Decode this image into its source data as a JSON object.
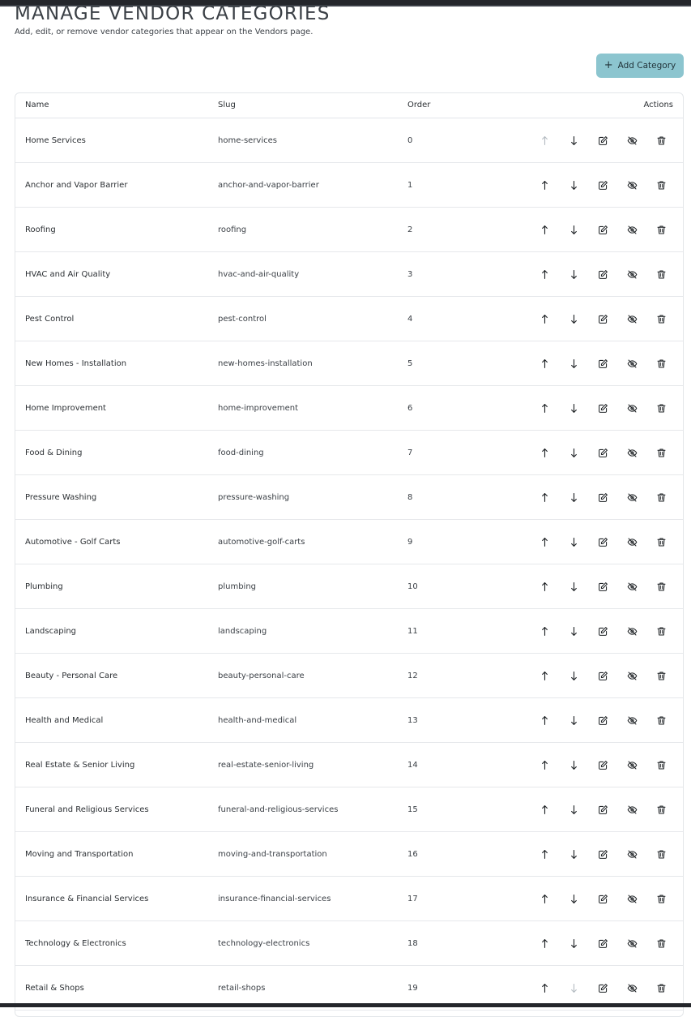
{
  "header": {
    "title": "MANAGE VENDOR CATEGORIES",
    "subtitle": "Add, edit, or remove vendor categories that appear on the Vendors page."
  },
  "toolbar": {
    "add_label": "Add Category",
    "add_icon": "plus-icon"
  },
  "table": {
    "columns": {
      "name": "Name",
      "slug": "Slug",
      "order": "Order",
      "actions": "Actions"
    },
    "action_icons": [
      "arrow-up-icon",
      "arrow-down-icon",
      "edit-icon",
      "eye-off-icon",
      "trash-icon"
    ],
    "rows": [
      {
        "name": "Home Services",
        "slug": "home-services",
        "order": "0"
      },
      {
        "name": "Anchor and Vapor Barrier",
        "slug": "anchor-and-vapor-barrier",
        "order": "1"
      },
      {
        "name": "Roofing",
        "slug": "roofing",
        "order": "2"
      },
      {
        "name": "HVAC and Air Quality",
        "slug": "hvac-and-air-quality",
        "order": "3"
      },
      {
        "name": "Pest Control",
        "slug": "pest-control",
        "order": "4"
      },
      {
        "name": "New Homes - Installation",
        "slug": "new-homes-installation",
        "order": "5"
      },
      {
        "name": "Home Improvement",
        "slug": "home-improvement",
        "order": "6"
      },
      {
        "name": "Food & Dining",
        "slug": "food-dining",
        "order": "7"
      },
      {
        "name": "Pressure Washing",
        "slug": "pressure-washing",
        "order": "8"
      },
      {
        "name": "Automotive - Golf Carts",
        "slug": "automotive-golf-carts",
        "order": "9"
      },
      {
        "name": "Plumbing",
        "slug": "plumbing",
        "order": "10"
      },
      {
        "name": "Landscaping",
        "slug": "landscaping",
        "order": "11"
      },
      {
        "name": "Beauty - Personal Care",
        "slug": "beauty-personal-care",
        "order": "12"
      },
      {
        "name": "Health and Medical",
        "slug": "health-and-medical",
        "order": "13"
      },
      {
        "name": "Real Estate & Senior Living",
        "slug": "real-estate-senior-living",
        "order": "14"
      },
      {
        "name": "Funeral and Religious Services",
        "slug": "funeral-and-religious-services",
        "order": "15"
      },
      {
        "name": "Moving and Transportation",
        "slug": "moving-and-transportation",
        "order": "16"
      },
      {
        "name": "Insurance & Financial Services",
        "slug": "insurance-financial-services",
        "order": "17"
      },
      {
        "name": "Technology & Electronics",
        "slug": "technology-electronics",
        "order": "18"
      },
      {
        "name": "Retail & Shops",
        "slug": "retail-shops",
        "order": "19"
      }
    ]
  },
  "colors": {
    "accent": "#8cc5cf",
    "disabled_icon": "#b5bcc2"
  }
}
